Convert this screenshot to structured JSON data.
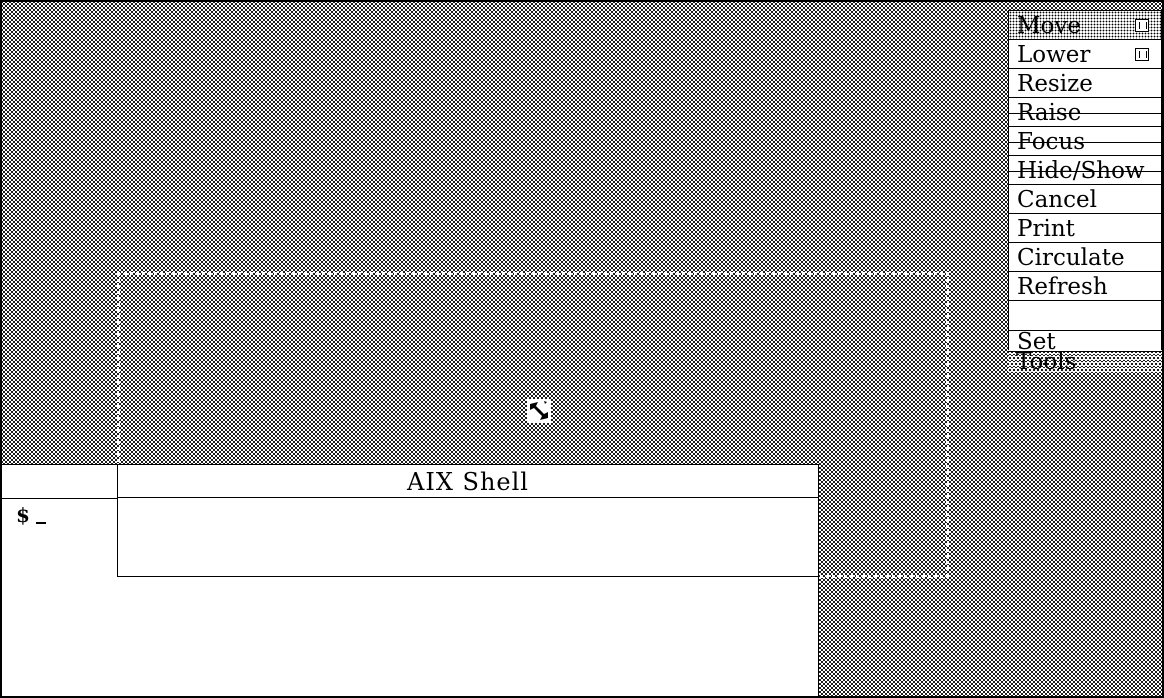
{
  "shell": {
    "title": "AIX Shell",
    "prompt": "$"
  },
  "wm_menu": {
    "items": [
      {
        "label": "Move",
        "shortcut_icon": "key-icon"
      },
      {
        "label": "Lower",
        "shortcut_icon": "key-icon"
      },
      {
        "label": "Resize"
      },
      {
        "label": "Raise"
      },
      {
        "label": "Focus"
      },
      {
        "label": "Hide/Show"
      },
      {
        "label": "Cancel"
      },
      {
        "label": "Print"
      },
      {
        "label": "Circulate"
      },
      {
        "label": "Refresh"
      },
      {
        "label": ""
      },
      {
        "label": "Set"
      }
    ],
    "tail_label": "Tools"
  },
  "colors": {
    "background_pattern": "#000000",
    "window": "#ffffff"
  }
}
